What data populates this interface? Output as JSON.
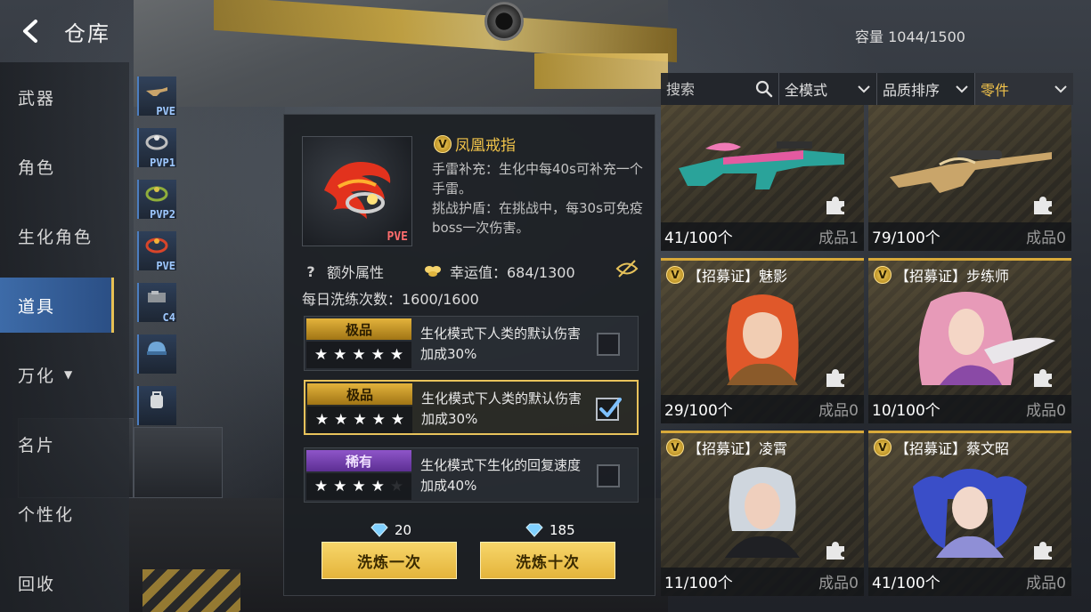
{
  "header": {
    "title": "仓库",
    "capacity_label": "容量",
    "capacity_value": "1044/1500"
  },
  "nav": {
    "items": [
      {
        "label": "武器"
      },
      {
        "label": "角色"
      },
      {
        "label": "生化角色"
      },
      {
        "label": "道具",
        "active": true
      },
      {
        "label": "万化",
        "has_caret": true
      },
      {
        "label": "名片"
      },
      {
        "label": "个性化"
      },
      {
        "label": "回收"
      }
    ]
  },
  "inventory_column": [
    {
      "tag": "PVE",
      "icon": "gun-icon"
    },
    {
      "tag": "PVP1",
      "icon": "ring-icon"
    },
    {
      "tag": "PVP2",
      "icon": "ring-icon"
    },
    {
      "tag": "PVE",
      "icon": "ring-icon"
    },
    {
      "tag": "C4",
      "icon": "c4-icon"
    },
    {
      "tag": "",
      "icon": "helmet-icon"
    },
    {
      "tag": "",
      "icon": "backpack-icon"
    }
  ],
  "detail": {
    "item_tag": "PVE",
    "name": "凤凰戒指",
    "description_1": "手雷补充：生化中每40s可补充一个手雷。",
    "description_2": "挑战护盾：在挑战中，每30s可免疫boss一次伤害。",
    "extra_attr_label": "额外属性",
    "luck_label": "幸运值：684/1300",
    "daily_label": "每日洗练次数：1600/1600",
    "attributes": [
      {
        "grade": "极品",
        "grade_color": "gold",
        "stars": 5,
        "max_stars": 5,
        "text": "生化模式下人类的默认伤害加成30%",
        "checked": false
      },
      {
        "grade": "极品",
        "grade_color": "gold",
        "stars": 5,
        "max_stars": 5,
        "text": "生化模式下人类的默认伤害加成30%",
        "checked": true
      },
      {
        "grade": "稀有",
        "grade_color": "purple",
        "stars": 4,
        "max_stars": 5,
        "text": "生化模式下生化的回复速度加成40%",
        "checked": false
      }
    ],
    "cost_once": "20",
    "cost_ten": "185",
    "refine_once_label": "洗炼一次",
    "refine_ten_label": "洗炼十次"
  },
  "filters": {
    "search_placeholder": "搜索",
    "mode": "全模式",
    "sort": "品质排序",
    "category": "零件"
  },
  "cards": [
    {
      "title": "",
      "art": "rifle-art",
      "count": "41/100个",
      "status": "成品1"
    },
    {
      "title": "",
      "art": "sniper-art",
      "count": "79/100个",
      "status": "成品0"
    },
    {
      "title": "【招募证】魅影",
      "art": "redhair-art",
      "count": "29/100个",
      "status": "成品0"
    },
    {
      "title": "【招募证】步练师",
      "art": "pinkhair-art",
      "count": "10/100个",
      "status": "成品0"
    },
    {
      "title": "【招募证】凌霄",
      "art": "silverhair-art",
      "count": "11/100个",
      "status": "成品0"
    },
    {
      "title": "【招募证】蔡文昭",
      "art": "bluehair-art",
      "count": "41/100个",
      "status": "成品0"
    }
  ],
  "colors": {
    "accent_gold": "#e9c35b",
    "nav_active": "#3d6ba8",
    "purple_grade": "#8e55c9"
  }
}
